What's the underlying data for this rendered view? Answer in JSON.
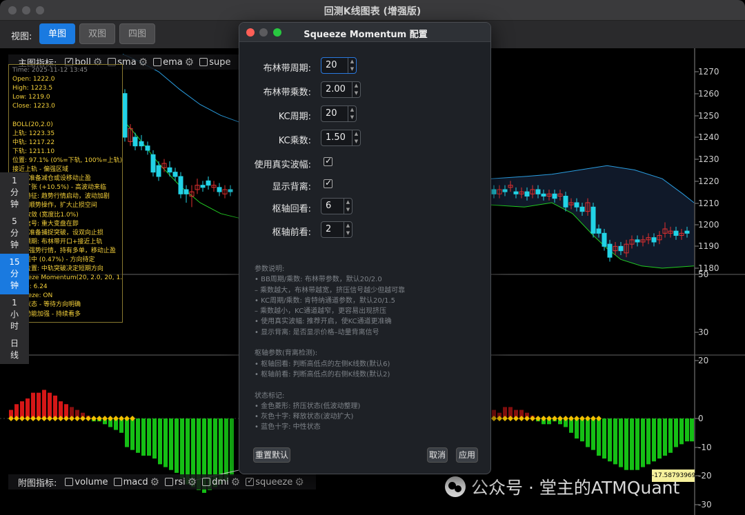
{
  "window": {
    "title": "回测K线图表 (增强版)"
  },
  "toolbar": {
    "view_label": "视图:",
    "views": [
      "单图",
      "双图",
      "四图"
    ],
    "active_view": "单图"
  },
  "main_indicators": {
    "label": "主图指标:",
    "items": [
      {
        "name": "boll",
        "checked": true
      },
      {
        "name": "sma",
        "checked": false
      },
      {
        "name": "ema",
        "checked": false
      },
      {
        "name": "supe",
        "checked": false
      }
    ]
  },
  "sub_indicators": {
    "label": "附图指标:",
    "items": [
      {
        "name": "volume",
        "checked": false
      },
      {
        "name": "macd",
        "checked": false
      },
      {
        "name": "rsi",
        "checked": false
      },
      {
        "name": "dmi",
        "checked": false
      },
      {
        "name": "squeeze",
        "checked": true
      }
    ]
  },
  "info_panel": {
    "lines": [
      "Time: 2025-11-12 13:45",
      "Open: 1222.0",
      "High: 1223.5",
      "Low: 1219.0",
      "Close: 1223.0",
      "",
      "BOLL(20,2.0)",
      "上轨: 1223.35",
      "中轨: 1217.22",
      "下轨: 1211.10",
      "位置: 97.1% (0%=下轨, 100%=上轨)",
      "接近上轨 - 偏强区域",
      "操作: 准备减仓或设移动止盈",
      "加速扩张 (+10.5%) - 高波动来临",
      "波动特征: 趋势行情启动，波动加剧",
      "策略: 顺势操作，扩大止损空间",
      "极度收敛 (宽度比1.0%)",
      "重要信号: 重大变盘在即",
      "操作: 准备捕捉突破，设双向止损",
      "经典预期: 布林带开口+接近上轨",
      "操作: 强势行情，持有多单，移动止盈",
      "通道适中 (0.47%) - 方向待定",
      "中轨位置: 中轨突破决定短期方向",
      "Squeeze Momentum(20, 2.0, 20, 1.5)",
      "Value: 6.24",
      "Squeeze: ON",
      "挤压状态 - 等待方向明确",
      "多头动能加强 - 持续看多"
    ]
  },
  "timeframes": {
    "items": [
      "1\n分\n钟",
      "5\n分\n钟",
      "15\n分\n钟",
      "1\n小\n时",
      "日\n线"
    ],
    "active": "15\n分\n钟"
  },
  "price_axis": {
    "labels": [
      "1270",
      "1260",
      "1250",
      "1240",
      "1230",
      "1220",
      "1210",
      "1200",
      "1190",
      "1180"
    ]
  },
  "rsi_axis": {
    "labels": [
      "50",
      "30"
    ]
  },
  "squeeze_axis": {
    "labels": [
      "20",
      "0",
      "-10",
      "-20",
      "-30"
    ]
  },
  "current_value_tag": "-17.58793969",
  "watermark": "公众号 · 堂主的ATMQuant",
  "dialog": {
    "title": "Squeeze Momentum 配置",
    "fields": [
      {
        "label": "布林带周期:",
        "value": "20"
      },
      {
        "label": "布林带乘数:",
        "value": "2.00"
      },
      {
        "label": "KC周期:",
        "value": "20"
      },
      {
        "label": "KC乘数:",
        "value": "1.50"
      }
    ],
    "checks": [
      {
        "label": "使用真实波幅:",
        "checked": true
      },
      {
        "label": "显示背离:",
        "checked": true
      }
    ],
    "pivot_fields": [
      {
        "label": "枢轴回看:",
        "value": "6"
      },
      {
        "label": "枢轴前看:",
        "value": "2"
      }
    ],
    "help_lines": [
      "参数说明:",
      "• BB周期/乘数: 布林带参数，默认20/2.0",
      "  – 乘数越大，布林带越宽，挤压信号越少但越可靠",
      "• KC周期/乘数: 肯特纳通道参数，默认20/1.5",
      "  – 乘数越小，KC通道越窄，更容易出现挤压",
      "• 使用真实波幅: 推荐开启，使KC通道更准确",
      "• 显示背离: 是否显示价格–动量背离信号",
      "",
      "枢轴参数(背离检测):",
      "• 枢轴回看: 判断高低点的左侧K线数(默认6)",
      "• 枢轴前看: 判断高低点的右侧K线数(默认2)",
      "",
      "状态标记:",
      "• 金色菱形: 挤压状态(低波动整理)",
      "• 灰色十字: 释放状态(波动扩大)",
      "• 蓝色十字: 中性状态"
    ],
    "reset_label": "重置默认",
    "cancel_label": "取消",
    "apply_label": "应用"
  },
  "colors": {
    "accent": "#1a7ae0",
    "bull_candle": "#22d3e6",
    "bear_candle": "#e03030",
    "upper_band": "#2a9de0",
    "lower_band": "#22cc22",
    "squeeze_diamond": "#f0c000",
    "hist_green": "#16c916",
    "hist_red": "#e01818"
  }
}
